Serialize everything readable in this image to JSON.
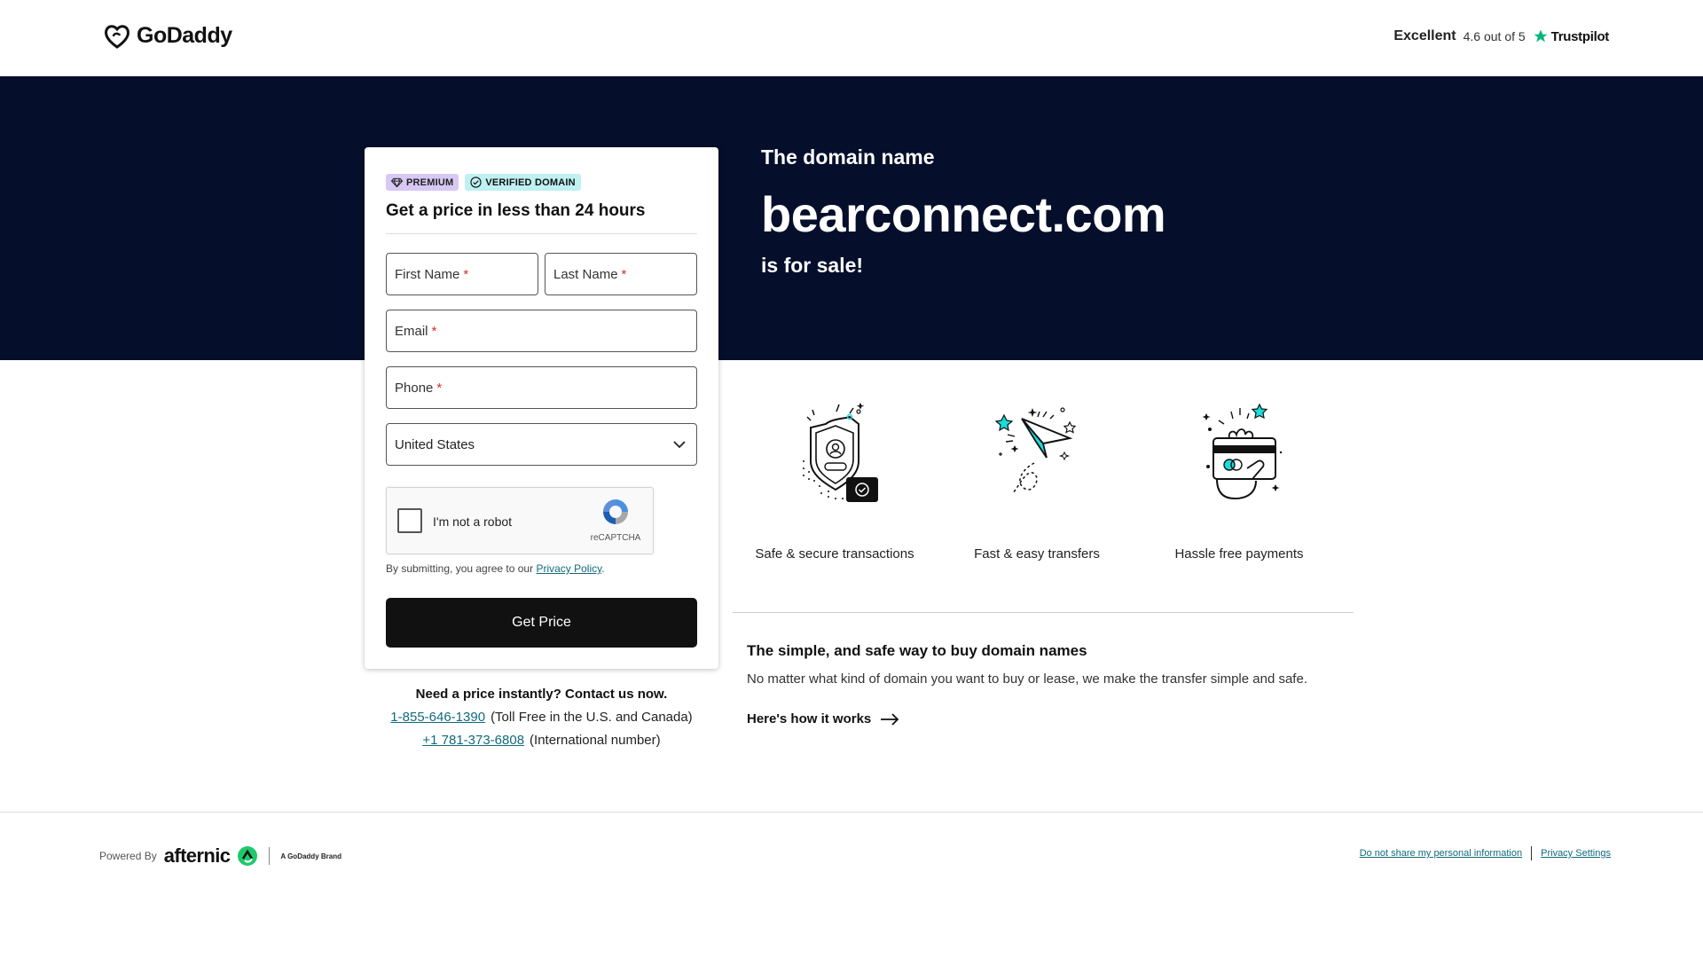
{
  "header": {
    "logo_text": "GoDaddy",
    "trust_excellent": "Excellent",
    "trust_rating": "4.6 out of 5",
    "trust_brand": "Trustpilot"
  },
  "hero": {
    "subtitle": "The domain name",
    "domain": "bearconnect.com",
    "for_sale": "is for sale!"
  },
  "form": {
    "badge_premium": "PREMIUM",
    "badge_verified": "VERIFIED DOMAIN",
    "title": "Get a price in less than 24 hours",
    "first_name": "First Name",
    "last_name": "Last Name",
    "email": "Email",
    "phone": "Phone",
    "required_mark": "*",
    "country": "United States",
    "captcha_label": "I'm not a robot",
    "captcha_brand": "reCAPTCHA",
    "terms_prefix": "By submitting, you agree to our",
    "terms_link": "Privacy Policy",
    "terms_suffix": ".",
    "submit": "Get Price"
  },
  "contact": {
    "heading": "Need a price instantly? Contact us now.",
    "tollfree_number": "1-855-646-1390",
    "tollfree_note": "(Toll Free in the U.S. and Canada)",
    "intl_number": "+1 781-373-6808",
    "intl_note": "(International number)"
  },
  "features": [
    {
      "label": "Safe & secure transactions",
      "icon": "shield-icon"
    },
    {
      "label": "Fast & easy transfers",
      "icon": "paper-plane-icon"
    },
    {
      "label": "Hassle free payments",
      "icon": "card-payment-icon"
    }
  ],
  "info": {
    "title": "The simple, and safe way to buy domain names",
    "body": "No matter what kind of domain you want to buy or lease, we make the transfer simple and safe.",
    "link": "Here's how it works"
  },
  "footer": {
    "powered_by": "Powered By",
    "afternic": "afternic",
    "brand_tag": "A GoDaddy Brand",
    "link_do_not_share": "Do not share my personal information",
    "link_privacy_settings": "Privacy Settings"
  },
  "colors": {
    "hero_bg": "#050f2c",
    "link": "#116a7b",
    "button_bg": "#111111",
    "premium_badge": "#d8c8f5",
    "verified_badge": "#bff0f2",
    "accent_teal": "#1bdbdb",
    "afternic_green": "#1ec96b"
  }
}
